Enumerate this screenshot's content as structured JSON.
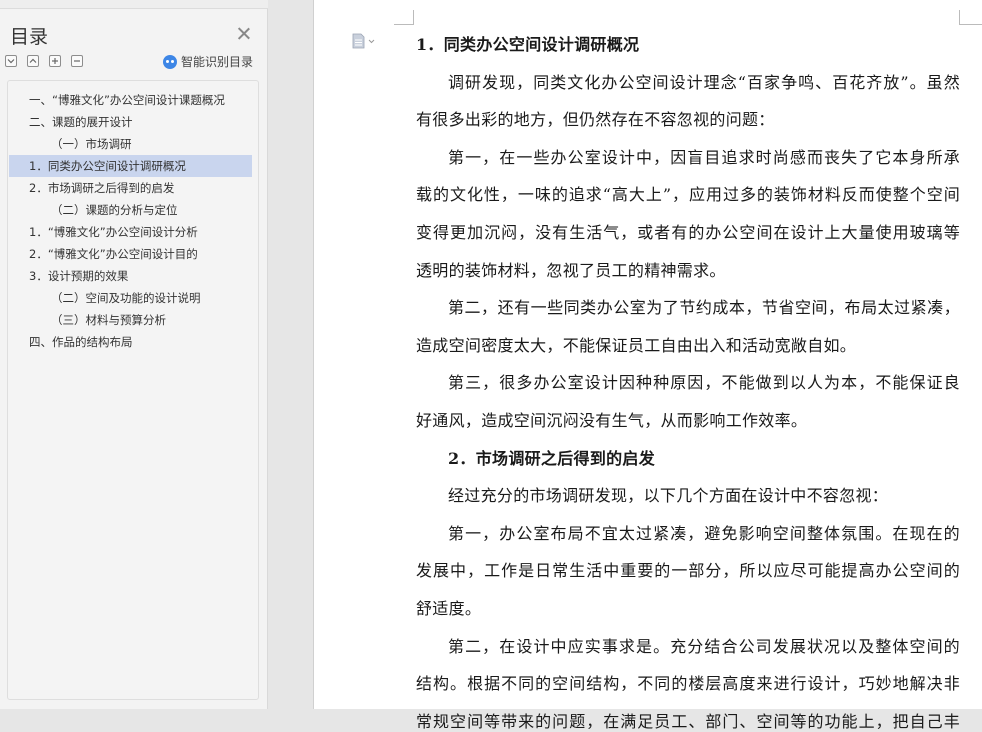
{
  "sidebar": {
    "title": "目录",
    "smart_toc_label": "智能识别目录",
    "items": [
      {
        "label": "一、“博雅文化”办公空间设计课题概况",
        "indent": 20,
        "selected": false
      },
      {
        "label": "二、课题的展开设计",
        "indent": 20,
        "selected": false
      },
      {
        "label": "（一）市场调研",
        "indent": 42,
        "selected": false
      },
      {
        "label": "1．同类办公空间设计调研概况",
        "indent": 20,
        "selected": true
      },
      {
        "label": "2．市场调研之后得到的启发",
        "indent": 20,
        "selected": false
      },
      {
        "label": "（二）课题的分析与定位",
        "indent": 42,
        "selected": false
      },
      {
        "label": "1．“博雅文化”办公空间设计分析",
        "indent": 20,
        "selected": false
      },
      {
        "label": "2．“博雅文化”办公空间设计目的",
        "indent": 20,
        "selected": false
      },
      {
        "label": "3．设计预期的效果",
        "indent": 20,
        "selected": false
      },
      {
        "label": "（二）空间及功能的设计说明",
        "indent": 42,
        "selected": false
      },
      {
        "label": "（三）材料与预算分析",
        "indent": 42,
        "selected": false
      },
      {
        "label": "四、作品的结构布局",
        "indent": 20,
        "selected": false
      }
    ]
  },
  "document": {
    "lines": [
      {
        "text": "1．同类办公空间设计调研概况",
        "style": "heading",
        "indent": 0
      },
      {
        "text": "调研发现，同类文化办公空间设计理念“百家争鸣、百花齐放”。虽然",
        "style": "just",
        "indent": 32
      },
      {
        "text": "有很多出彩的地方，但仍然存在不容忽视的问题：",
        "style": "",
        "indent": 0
      },
      {
        "text": "第一，在一些办公室设计中，因盲目追求时尚感而丧失了它本身所承",
        "style": "just",
        "indent": 32
      },
      {
        "text": "载的文化性，一味的追求“高大上”，应用过多的装饰材料反而使整个空间",
        "style": "just",
        "indent": 0
      },
      {
        "text": "变得更加沉闷，没有生活气，或者有的办公空间在设计上大量使用玻璃等",
        "style": "just",
        "indent": 0
      },
      {
        "text": "透明的装饰材料，忽视了员工的精神需求。",
        "style": "",
        "indent": 0
      },
      {
        "text": "第二，还有一些同类办公室为了节约成本，节省空间，布局太过紧凑，",
        "style": "just",
        "indent": 32
      },
      {
        "text": "造成空间密度太大，不能保证员工自由出入和活动宽敞自如。",
        "style": "",
        "indent": 0
      },
      {
        "text": "第三，很多办公室设计因种种原因，不能做到以人为本，不能保证良",
        "style": "just",
        "indent": 32
      },
      {
        "text": "好通风，造成空间沉闷没有生气，从而影响工作效率。",
        "style": "",
        "indent": 0
      },
      {
        "text": "2．市场调研之后得到的启发",
        "style": "heading",
        "indent": 32
      },
      {
        "text": "经过充分的市场调研发现，以下几个方面在设计中不容忽视：",
        "style": "",
        "indent": 32
      },
      {
        "text": "第一，办公室布局不宜太过紧凑，避免影响空间整体氛围。在现在的",
        "style": "just",
        "indent": 32
      },
      {
        "text": "发展中，工作是日常生活中重要的一部分，所以应尽可能提高办公空间的",
        "style": "just",
        "indent": 0
      },
      {
        "text": "舒适度。",
        "style": "",
        "indent": 0
      },
      {
        "text": "第二，在设计中应实事求是。充分结合公司发展状况以及整体空间的",
        "style": "just",
        "indent": 32
      },
      {
        "text": "结构。根据不同的空间结构，不同的楼层高度来进行设计，巧妙地解决非",
        "style": "just",
        "indent": 0
      },
      {
        "text": "常规空间等带来的问题，在满足员工、部门、空间等的功能上，把自己丰",
        "style": "just",
        "indent": 0
      }
    ]
  }
}
